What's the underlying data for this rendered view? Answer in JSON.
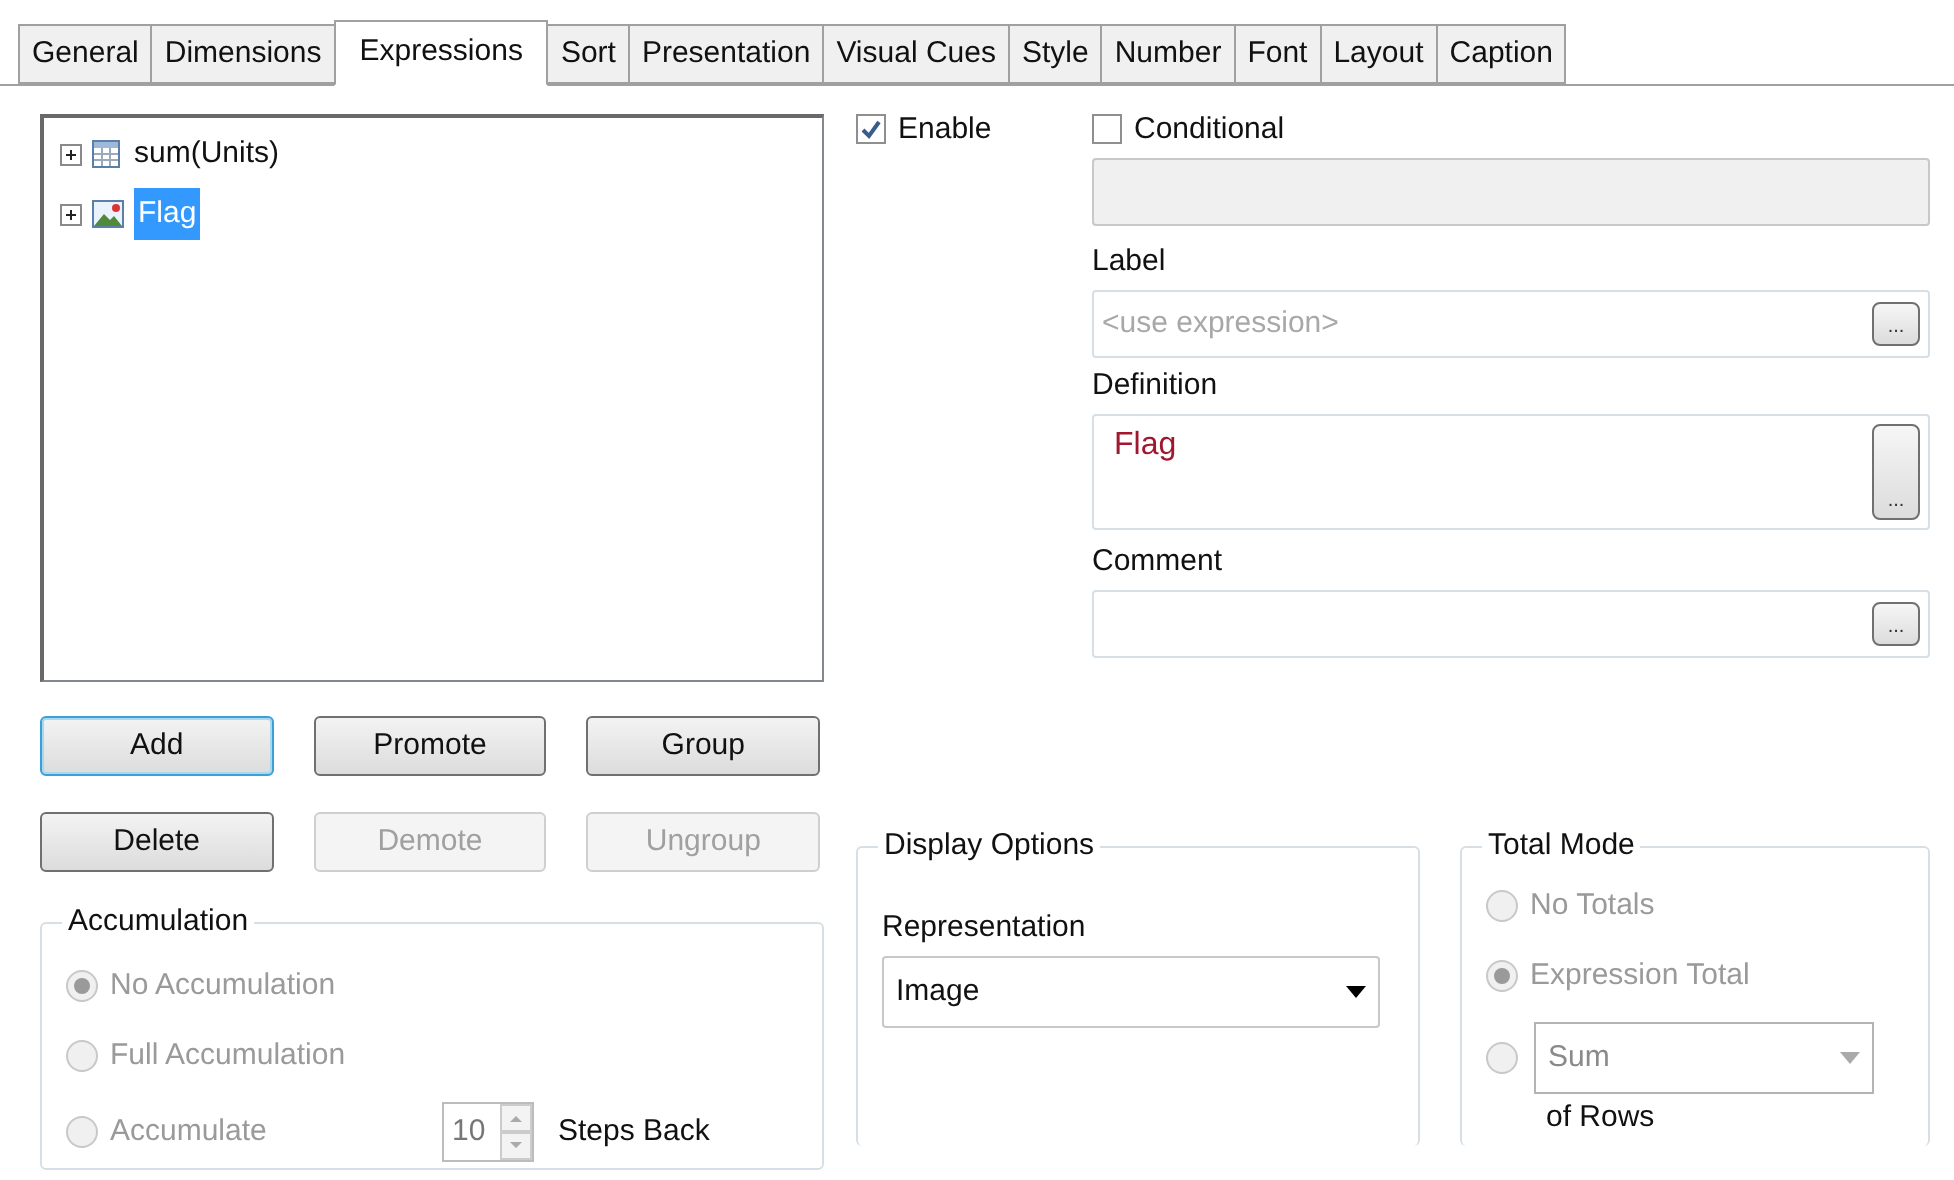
{
  "tabs": [
    {
      "label": "General",
      "selected": false
    },
    {
      "label": "Dimensions",
      "selected": false
    },
    {
      "label": "Expressions",
      "selected": true
    },
    {
      "label": "Sort",
      "selected": false
    },
    {
      "label": "Presentation",
      "selected": false
    },
    {
      "label": "Visual Cues",
      "selected": false
    },
    {
      "label": "Style",
      "selected": false
    },
    {
      "label": "Number",
      "selected": false
    },
    {
      "label": "Font",
      "selected": false
    },
    {
      "label": "Layout",
      "selected": false
    },
    {
      "label": "Caption",
      "selected": false
    }
  ],
  "expressions_tree": [
    {
      "label": "sum(Units)",
      "kind": "table",
      "selected": false,
      "expanded": false
    },
    {
      "label": "Flag",
      "kind": "image",
      "selected": true,
      "expanded": false
    }
  ],
  "enable": {
    "label": "Enable",
    "checked": true
  },
  "conditional": {
    "label": "Conditional",
    "checked": false
  },
  "label_field": {
    "label": "Label",
    "placeholder": "<use expression>",
    "button": "..."
  },
  "definition_field": {
    "label": "Definition",
    "value": "Flag",
    "button": "..."
  },
  "comment_field": {
    "label": "Comment",
    "button": "..."
  },
  "buttons": [
    {
      "label": "Add",
      "disabled": false,
      "focused": true
    },
    {
      "label": "Promote",
      "disabled": false,
      "focused": false
    },
    {
      "label": "Group",
      "disabled": false,
      "focused": false
    },
    {
      "label": "Delete",
      "disabled": false,
      "focused": false
    },
    {
      "label": "Demote",
      "disabled": true,
      "focused": false
    },
    {
      "label": "Ungroup",
      "disabled": true,
      "focused": false
    }
  ],
  "accumulation": {
    "title": "Accumulation",
    "options": [
      {
        "kind": "plain",
        "label": "No Accumulation",
        "selected": true,
        "disabled": true
      },
      {
        "kind": "plain",
        "label": "Full Accumulation",
        "selected": false,
        "disabled": true
      },
      {
        "kind": "steps",
        "label": "Accumulate",
        "selected": false,
        "disabled": true,
        "value": "10",
        "suffix": "Steps Back"
      }
    ]
  },
  "display_options": {
    "title": "Display Options",
    "representation_label": "Representation",
    "representation": "Image"
  },
  "total_mode": {
    "title": "Total Mode",
    "options": [
      {
        "kind": "plain",
        "label": "No Totals",
        "selected": false,
        "disabled": true
      },
      {
        "kind": "plain",
        "label": "Expression Total",
        "selected": true,
        "disabled": true
      },
      {
        "kind": "dropdown",
        "value": "Sum",
        "selected": false,
        "disabled": true,
        "suffix": "of Rows"
      }
    ]
  }
}
